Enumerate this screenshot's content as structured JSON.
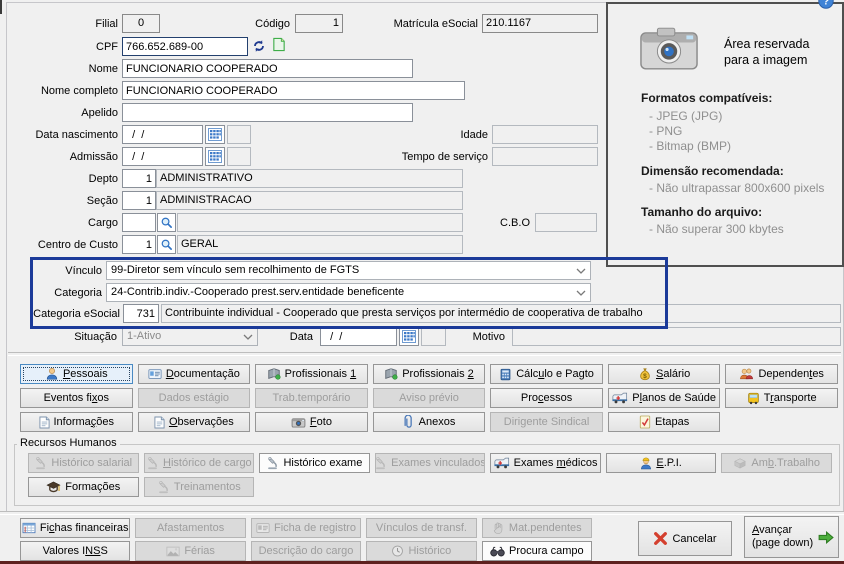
{
  "colors": {
    "highlight_border": "#1b3a99",
    "bottom_edge": "#5e211f"
  },
  "fields": {
    "filial": {
      "label": "Filial",
      "value": "0"
    },
    "codigo": {
      "label": "Código",
      "value": "1"
    },
    "matricula_esocial": {
      "label": "Matrícula eSocial",
      "value": "210.1167"
    },
    "cpf": {
      "label": "CPF",
      "value": "766.652.689-00"
    },
    "nome": {
      "label": "Nome",
      "value": "FUNCIONARIO COOPERADO"
    },
    "nome_completo": {
      "label": "Nome completo",
      "value": "FUNCIONARIO COOPERADO"
    },
    "apelido": {
      "label": "Apelido",
      "value": ""
    },
    "data_nascimento": {
      "label": "Data nascimento",
      "value": "  /  /"
    },
    "idade": {
      "label": "Idade",
      "value": ""
    },
    "admissao": {
      "label": "Admissão",
      "value": "  /  /"
    },
    "tempo_servico": {
      "label": "Tempo de serviço",
      "value": ""
    },
    "depto": {
      "label": "Depto",
      "code": "1",
      "desc": "ADMINISTRATIVO"
    },
    "secao": {
      "label": "Seção",
      "code": "1",
      "desc": "ADMINISTRACAO"
    },
    "cargo": {
      "label": "Cargo",
      "code": "",
      "desc": ""
    },
    "cbo": {
      "label": "C.B.O",
      "value": ""
    },
    "centro_custo": {
      "label": "Centro de Custo",
      "code": "1",
      "desc": "GERAL"
    },
    "vinculo": {
      "label": "Vínculo",
      "value": "99-Diretor sem vínculo sem recolhimento de FGTS"
    },
    "categoria": {
      "label": "Categoria",
      "value": "24-Contrib.indiv.-Cooperado prest.serv.entidade beneficente"
    },
    "categoria_esocial": {
      "label": "Categoria eSocial",
      "code": "731",
      "desc": "Contribuinte individual - Cooperado que presta serviços por intermédio de cooperativa de trabalho"
    },
    "situacao": {
      "label": "Situação",
      "value": "1-Ativo"
    },
    "data": {
      "label": "Data",
      "value": "  /  /"
    },
    "motivo": {
      "label": "Motivo",
      "value": ""
    }
  },
  "photo_panel": {
    "reserved_line1": "Área reservada",
    "reserved_line2": "para a imagem",
    "formats_title": "Formatos compatíveis:",
    "formats": [
      "- JPEG (JPG)",
      "- PNG",
      "- Bitmap (BMP)"
    ],
    "dimension_title": "Dimensão recomendada:",
    "dimension_item": "- Não ultrapassar 800x600 pixels",
    "size_title": "Tamanho do arquivo:",
    "size_item": "- Não superar 300 kbytes"
  },
  "tabs": {
    "rows": [
      [
        {
          "label": "Pessoais",
          "u_at": 0,
          "icon": "person",
          "state": "focused"
        },
        {
          "label": "Documentação",
          "u_at": 0,
          "icon": "card"
        },
        {
          "label": "Profissionais 1",
          "u_at": 14,
          "icon": "book"
        },
        {
          "label": "Profissionais 2",
          "u_at": 14,
          "icon": "book"
        },
        {
          "label": "Cálculo e Pagto",
          "u_at": 4,
          "icon": "calculator"
        },
        {
          "label": "Salário",
          "u_at": 0,
          "icon": "moneybag"
        },
        {
          "label": "Dependentes",
          "u_at": 8,
          "icon": "people"
        }
      ],
      [
        {
          "label": "Eventos fixos",
          "u_at": 10
        },
        {
          "label": "Dados estágio",
          "u_at": 10,
          "state": "disabled"
        },
        {
          "label": "Trab.temporário",
          "state": "disabled"
        },
        {
          "label": "Aviso prévio",
          "state": "disabled"
        },
        {
          "label": "Processos",
          "u_at": 3
        },
        {
          "label": "Planos de Saúde",
          "u_at": 1,
          "icon": "ambulance"
        },
        {
          "label": "Transporte",
          "u_at": 1,
          "icon": "bus"
        }
      ],
      [
        {
          "label": "Informações",
          "u_at": 7,
          "icon": "doc"
        },
        {
          "label": "Observações",
          "u_at": 0,
          "icon": "doc"
        },
        {
          "label": "Foto",
          "u_at": 0,
          "icon": "camera"
        },
        {
          "label": "Anexos",
          "icon": "paperclip"
        },
        {
          "label": "Dirigente Sindical",
          "state": "disabled"
        },
        {
          "label": "Etapas",
          "icon": "checkdoc"
        },
        null
      ]
    ]
  },
  "rh": {
    "title": "Recursos Humanos",
    "rows": [
      [
        {
          "label": "Histórico salarial",
          "icon": "microscope",
          "state": "disabled"
        },
        {
          "label": "Histórico de cargo",
          "u_at": 0,
          "icon": "microscope",
          "state": "disabled"
        },
        {
          "label": "Histórico exame",
          "icon": "microscope",
          "state": "white"
        },
        {
          "label": "Exames vinculados",
          "icon": "microscope",
          "state": "disabled"
        },
        {
          "label": "Exames médicos",
          "u_at": 7,
          "icon": "ambulance"
        },
        {
          "label": "E.P.I.",
          "u_at": 0,
          "icon": "worker"
        },
        {
          "label": "Amb.Trabalho",
          "u_at": 2,
          "icon": "box",
          "state": "disabled"
        }
      ],
      [
        {
          "label": "Formações",
          "icon": "gradcap"
        },
        {
          "label": "Treinamentos",
          "icon": "microscope",
          "state": "disabled"
        }
      ]
    ]
  },
  "bottom": {
    "rows": [
      [
        {
          "label": "Fichas financeiras",
          "u_at": 2,
          "icon": "table"
        },
        {
          "label": "Afastamentos",
          "state": "disabled"
        },
        {
          "label": "Ficha de registro",
          "icon": "card",
          "state": "disabled"
        },
        {
          "label": "Vínculos de transf.",
          "state": "disabled"
        },
        {
          "label": "Mat.pendentes",
          "icon": "hand",
          "state": "disabled"
        }
      ],
      [
        {
          "label": "Valores INSS",
          "u_at": 9,
          "u_len": 2
        },
        {
          "label": "Férias",
          "icon": "image",
          "state": "disabled"
        },
        {
          "label": "Descrição do cargo",
          "state": "disabled"
        },
        {
          "label": "Histórico",
          "icon": "clock",
          "state": "disabled"
        },
        {
          "label": "Procura campo",
          "icon": "binoculars",
          "state": "white"
        }
      ]
    ]
  },
  "actions": {
    "cancel": {
      "label": "Cancelar"
    },
    "advance": {
      "line1": "Avançar",
      "u_at": 0,
      "line2": "(page down)"
    }
  }
}
